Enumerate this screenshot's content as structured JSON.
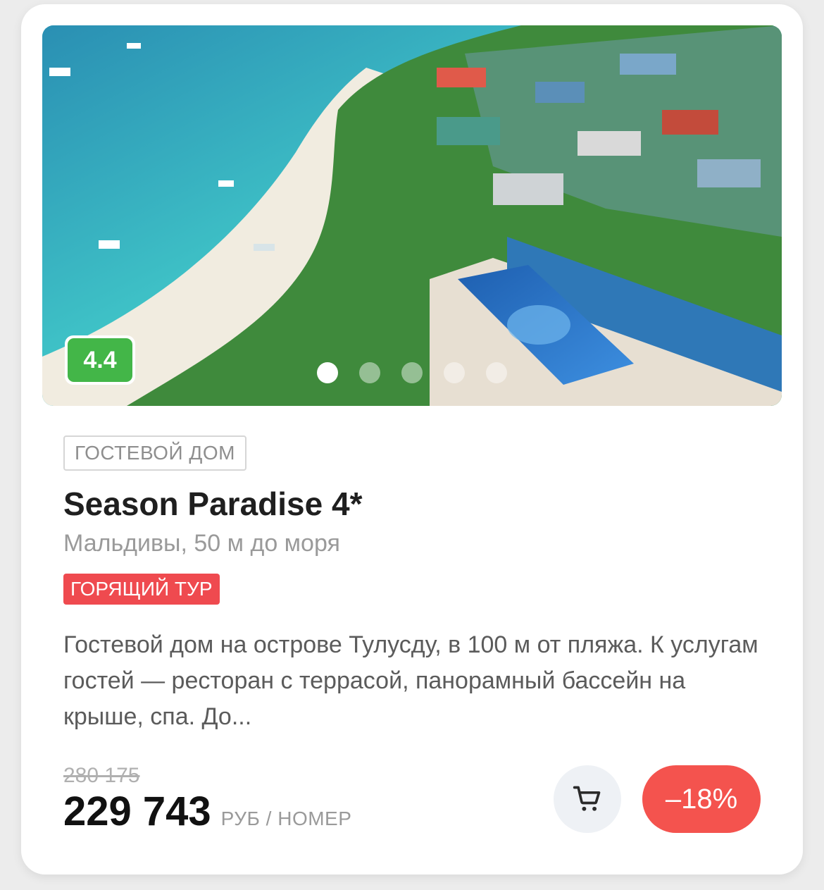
{
  "card": {
    "rating": "4.4",
    "gallery": {
      "slides": 5,
      "active_index": 0
    },
    "type_label": "ГОСТЕВОЙ ДОМ",
    "title": "Season Paradise 4*",
    "location": "Мальдивы, 50 м до моря",
    "hot_label": "ГОРЯЩИЙ ТУР",
    "description": "Гостевой дом на острове Тулусду, в 100 м от пляжа. К услугам гостей — ресторан с террасой, панорамный бассейн на крыше, спа. До...",
    "old_price": "280 175",
    "price": "229 743",
    "price_unit": "РУБ / НОМЕР",
    "discount": "–18%",
    "cart_icon": "cart-icon"
  },
  "colors": {
    "rating_bg": "#43b648",
    "hot_badge_bg": "#ef4a4f",
    "discount_bg": "#f4534e",
    "cart_bg": "#eef1f5"
  }
}
